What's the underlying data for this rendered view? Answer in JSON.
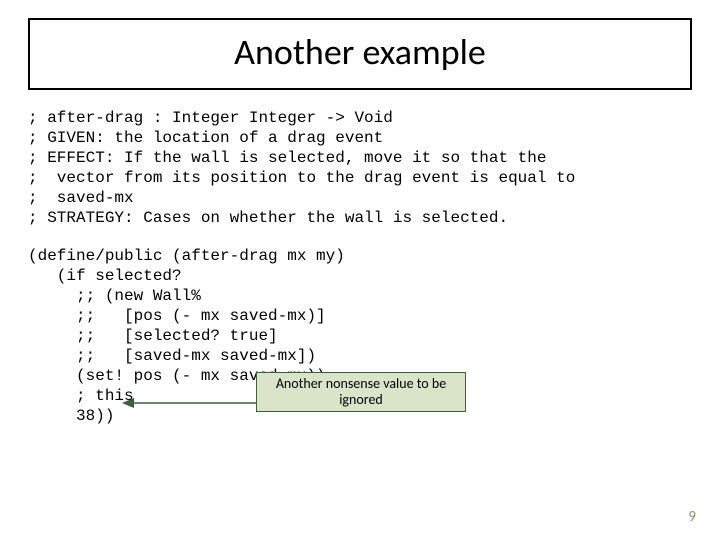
{
  "title": "Another example",
  "code": {
    "comments": "; after-drag : Integer Integer -> Void\n; GIVEN: the location of a drag event\n; EFFECT: If the wall is selected, move it so that the\n;  vector from its position to the drag event is equal to\n;  saved-mx\n; STRATEGY: Cases on whether the wall is selected.",
    "body": "(define/public (after-drag mx my)\n   (if selected?\n     ;; (new Wall%\n     ;;   [pos (- mx saved-mx)]\n     ;;   [selected? true]\n     ;;   [saved-mx saved-mx])\n     (set! pos (- mx saved-mx))\n     ; this\n     38))"
  },
  "callout": "Another nonsense value to be ignored",
  "page_number": "9"
}
